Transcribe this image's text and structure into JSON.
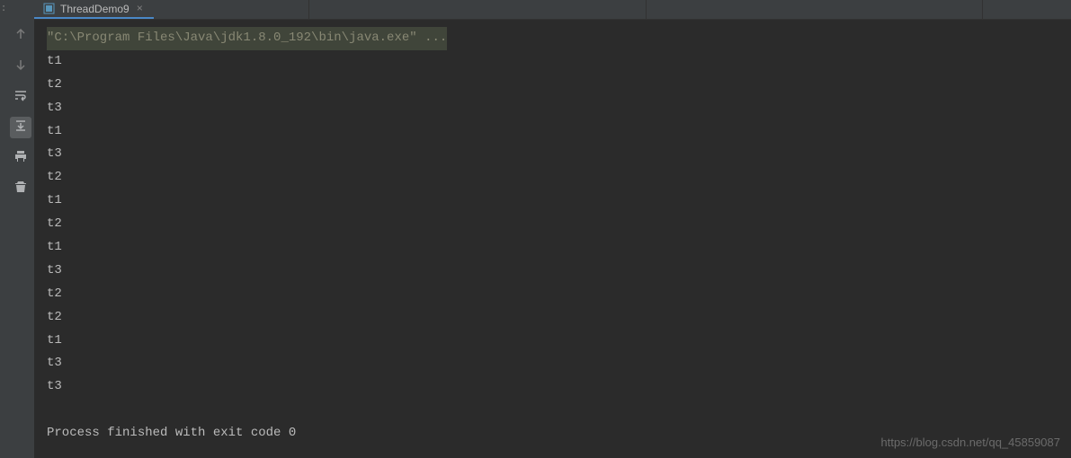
{
  "gutter": {
    "label": ":"
  },
  "tab": {
    "label": "ThreadDemo9",
    "close": "×"
  },
  "console": {
    "cmd": "\"C:\\Program Files\\Java\\jdk1.8.0_192\\bin\\java.exe\" ...",
    "lines": [
      "t1",
      "t2",
      "t3",
      "t1",
      "t3",
      "t2",
      "t1",
      "t2",
      "t1",
      "t3",
      "t2",
      "t2",
      "t1",
      "t3",
      "t3"
    ],
    "exit": "Process finished with exit code 0"
  },
  "watermark": "https://blog.csdn.net/qq_45859087"
}
